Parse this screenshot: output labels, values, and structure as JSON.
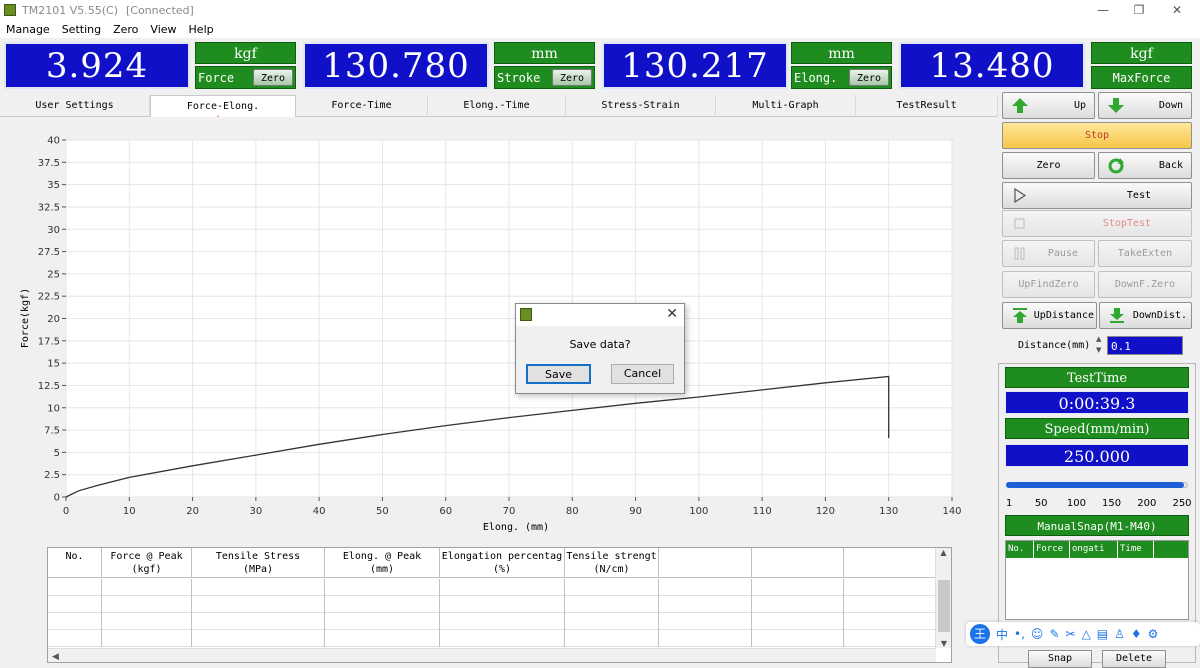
{
  "window": {
    "title": "TM2101 V5.55(C)",
    "status": "[Connected]",
    "controls": [
      "—",
      "❐",
      "✕"
    ]
  },
  "menu": [
    "Manage",
    "Setting",
    "Zero",
    "View",
    "Help"
  ],
  "readouts": {
    "force": {
      "value": "3.924",
      "unit": "kgf",
      "label": "Force",
      "zero": "Zero"
    },
    "stroke": {
      "value": "130.780",
      "unit": "mm",
      "label": "Stroke",
      "zero": "Zero"
    },
    "elong": {
      "value": "130.217",
      "unit": "mm",
      "label": "Elong.",
      "zero": "Zero"
    },
    "maxforce": {
      "value": "13.480",
      "unit": "kgf",
      "label": "MaxForce"
    }
  },
  "tabs": [
    "User Settings",
    "Force-Elong.",
    "Force-Time",
    "Elong.-Time",
    "Stress-Strain",
    "Multi-Graph",
    "TestResult"
  ],
  "active_tab": "Force-Elong.",
  "chart_data": {
    "type": "line",
    "xlabel": "Elong. (mm)",
    "ylabel": "Force(kgf)",
    "xlim": [
      0,
      140
    ],
    "ylim": [
      0,
      40
    ],
    "xticks": [
      0,
      10,
      20,
      30,
      40,
      50,
      60,
      70,
      80,
      90,
      100,
      110,
      120,
      130,
      140
    ],
    "yticks": [
      0,
      2.5,
      5,
      7.5,
      10,
      12.5,
      15,
      17.5,
      20,
      22.5,
      25,
      27.5,
      30,
      32.5,
      35,
      37.5,
      40
    ],
    "grid": true,
    "series": [
      {
        "x": [
          0,
          2,
          5,
          10,
          20,
          30,
          40,
          50,
          60,
          70,
          80,
          90,
          100,
          110,
          120,
          130,
          130,
          130
        ],
        "y": [
          0,
          0.7,
          1.3,
          2.2,
          3.5,
          4.7,
          5.9,
          7.0,
          8.0,
          8.9,
          9.7,
          10.5,
          11.2,
          12.0,
          12.8,
          13.5,
          9.0,
          6.6
        ]
      }
    ]
  },
  "dialog": {
    "message": "Save data?",
    "save": "Save",
    "cancel": "Cancel",
    "close": "✕"
  },
  "results_table": {
    "headers": [
      [
        "No.",
        ""
      ],
      [
        "Force @ Peak",
        "(kgf)"
      ],
      [
        "Tensile Stress",
        "(MPa)"
      ],
      [
        "Elong. @ Peak",
        "(mm)"
      ],
      [
        "Elongation percentag",
        "(%)"
      ],
      [
        "Tensile strengt",
        "(N/cm)"
      ],
      [
        "",
        ""
      ],
      [
        "",
        ""
      ],
      [
        "",
        ""
      ]
    ]
  },
  "right_panel": {
    "up": "Up",
    "down": "Down",
    "stop": "Stop",
    "zero": "Zero",
    "back": "Back",
    "test": "Test",
    "stoptest": "StopTest",
    "pause": "Pause",
    "takeexten": "TakeExten",
    "upfindzero": "UpFindZero",
    "downfzero": "DownF.Zero",
    "updistance": "UpDistance",
    "downdist": "DownDist.",
    "distance_label": "Distance(mm)",
    "distance_value": "0.1",
    "testtime_label": "TestTime",
    "testtime_value": "0:00:39.3",
    "speed_label": "Speed(mm/min)",
    "speed_value": "250.000",
    "slider_ticks": [
      "1",
      "50",
      "100",
      "150",
      "200",
      "250"
    ],
    "slider_value": 250,
    "slider_max": 250,
    "snap_label": "ManualSnap(M1-M40)",
    "snap_headers": [
      "No.",
      "Force",
      "ongati",
      "Time"
    ],
    "snap_btn": "Snap",
    "delete_btn": "Delete"
  },
  "ime_bar": {
    "label": "中",
    "icons": [
      "keyboard-punct",
      "emoji",
      "pen",
      "scissors",
      "cloud",
      "keyboard",
      "user",
      "skin",
      "settings"
    ]
  }
}
